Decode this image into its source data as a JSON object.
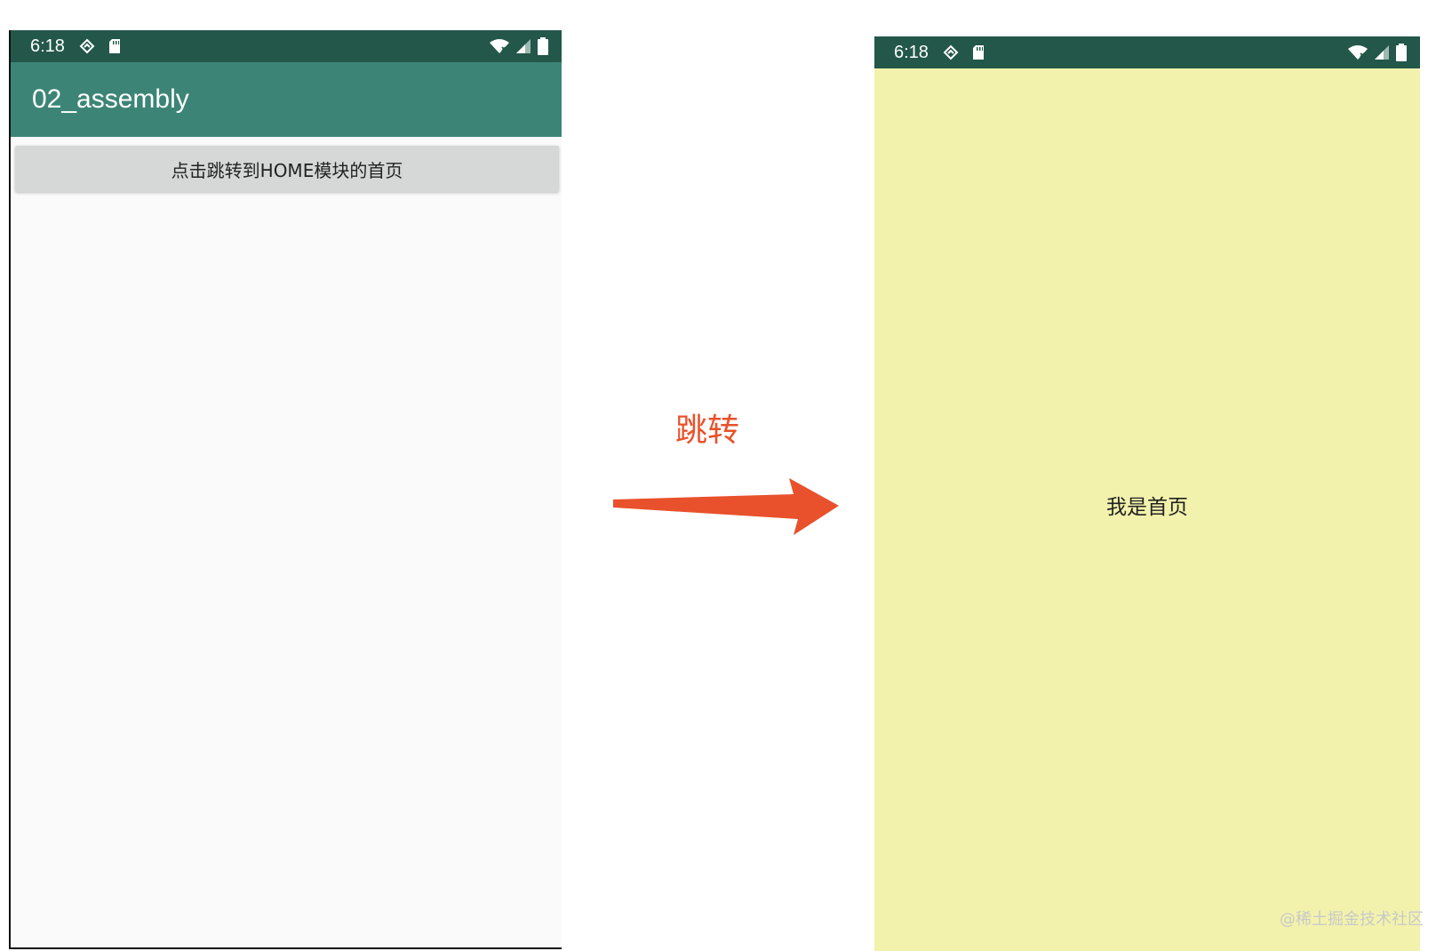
{
  "left_screen": {
    "status_time": "6:18",
    "app_title": "02_assembly",
    "button_label": "点击跳转到HOME模块的首页"
  },
  "transition": {
    "label": "跳转",
    "color": "#e8512b"
  },
  "right_screen": {
    "status_time": "6:18",
    "content_text": "我是首页",
    "background_color": "#f2f2ad"
  },
  "watermark": "@稀土掘金技术社区",
  "icons": {
    "status_left": [
      "sync-icon",
      "sd-card-icon"
    ],
    "status_right": [
      "wifi-icon",
      "signal-icon",
      "battery-icon"
    ]
  },
  "colors": {
    "status_bar": "#23574a",
    "app_bar": "#3c8576"
  }
}
